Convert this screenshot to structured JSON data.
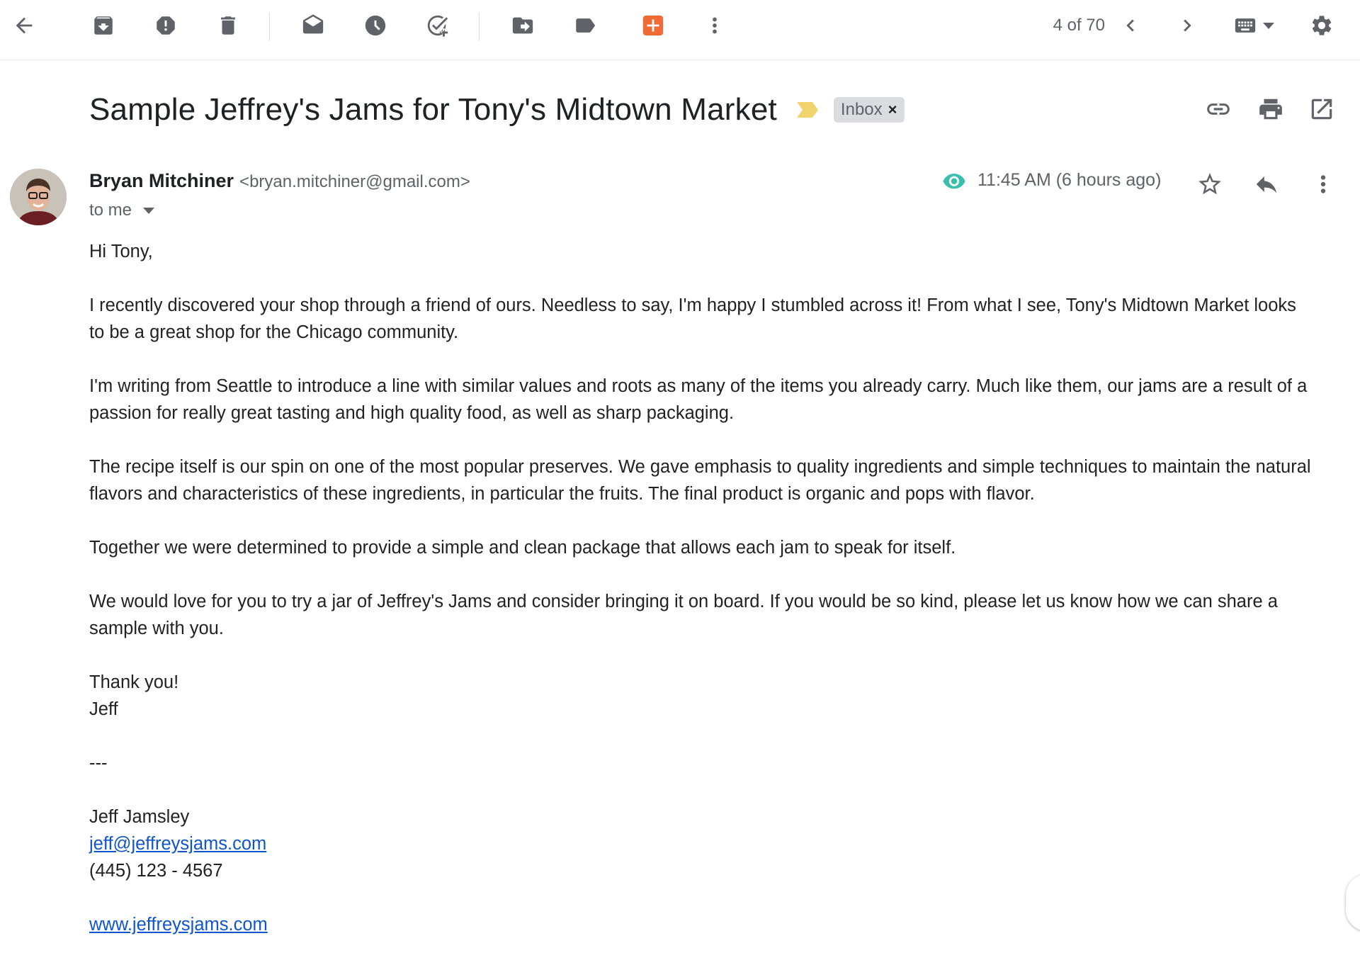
{
  "toolbar": {
    "back_icon": "arrow-left-icon",
    "actions": [
      "archive-icon",
      "report-spam-icon",
      "delete-icon",
      "mark-unread-icon",
      "snooze-icon",
      "add-task-icon",
      "move-to-icon",
      "label-icon",
      "addon-icon",
      "more-vert-icon"
    ],
    "page_count": "4 of 70",
    "addon_color": "#f06a35"
  },
  "message": {
    "subject": "Sample Jeffrey's Jams for Tony's Midtown Market",
    "label": "Inbox",
    "label_remove": "×",
    "importance_color": "#f2d46f",
    "sender_name": "Bryan Mitchiner",
    "sender_email": "<bryan.mitchiner@gmail.com>",
    "to": "to me",
    "timestamp": "11:45 AM (6 hours ago)",
    "tracking_color": "#3bbfad"
  },
  "body": {
    "greeting": "Hi Tony,",
    "p1": [
      "I recently discovered your shop through a friend of ours. Needless to say, I'm happy I stumbled across it! From what I see, Tony's Midtown Market looks",
      "to be a great shop for the Chicago community."
    ],
    "p2": [
      "I'm writing from Seattle to introduce a line with similar values and roots as many of the items you already carry. Much like them, our jams are a result of a",
      "passion for really great tasting and high quality food, as well as sharp packaging."
    ],
    "p3": [
      "The recipe itself is our spin on one of the most popular preserves. We gave emphasis to quality ingredients and simple techniques to maintain the natural",
      "flavors and characteristics of these ingredients, in particular the fruits. The final product is organic and pops with flavor."
    ],
    "p4": "Together we were determined to provide a simple and clean package that allows each jam to speak for itself.",
    "p5": [
      "We would love for you to try a jar of Jeffrey's Jams and consider bringing it on board. If you would be so kind, please let us know how we can share a",
      "sample with you."
    ],
    "closing": "Thank you!",
    "signoff": "Jeff",
    "divider": "---",
    "sig_name": "Jeff Jamsley",
    "sig_email": "jeff@jeffreysjams.com",
    "sig_phone": "(445) 123 - 4567",
    "sig_website": "www.jeffreysjams.com"
  }
}
